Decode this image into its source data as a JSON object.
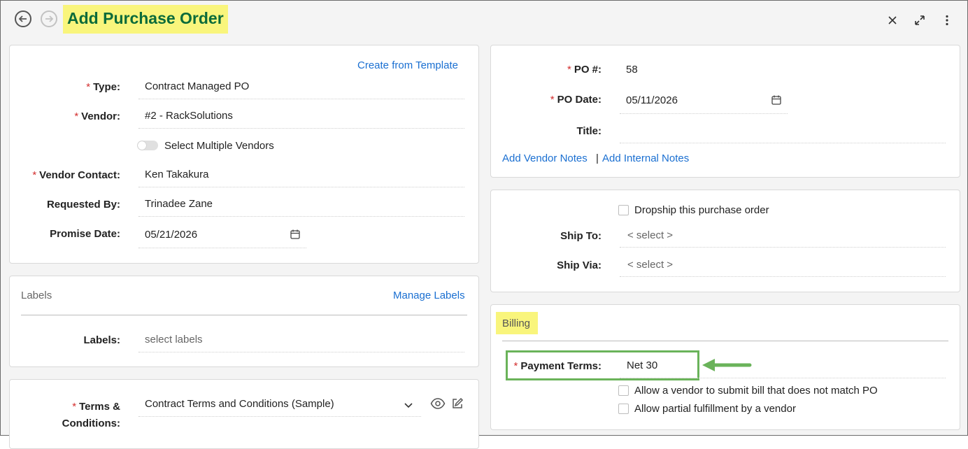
{
  "header": {
    "title": "Add Purchase Order",
    "back_icon": "arrow-left-circle-icon",
    "forward_icon": "arrow-right-circle-icon",
    "close_icon": "close-icon",
    "expand_icon": "expand-icon",
    "more_icon": "more-vertical-icon"
  },
  "general": {
    "create_from_template": "Create from Template",
    "type_label": "Type:",
    "type_value": "Contract Managed PO",
    "vendor_label": "Vendor:",
    "vendor_value": "#2 - RackSolutions",
    "multi_vendor_label": "Select Multiple Vendors",
    "vendor_contact_label": "Vendor Contact:",
    "vendor_contact_value": "Ken Takakura",
    "requested_by_label": "Requested By:",
    "requested_by_value": "Trinadee Zane",
    "promise_date_label": "Promise Date:",
    "promise_date_value": "05/21/2026"
  },
  "labels_section": {
    "title": "Labels",
    "manage_labels": "Manage Labels",
    "labels_label": "Labels:",
    "labels_placeholder": "select labels"
  },
  "terms": {
    "label_line1": "Terms &",
    "label_line2": "Conditions:",
    "value": "Contract Terms and Conditions (Sample)"
  },
  "po": {
    "po_num_label": "PO #:",
    "po_num_value": "58",
    "po_date_label": "PO Date:",
    "po_date_value": "05/11/2026",
    "title_label": "Title:",
    "add_vendor_notes": "Add Vendor Notes",
    "separator": "|",
    "add_internal_notes": "Add Internal Notes"
  },
  "shipping": {
    "dropship_label": "Dropship this purchase order",
    "ship_to_label": "Ship To:",
    "ship_to_value": "< select >",
    "ship_via_label": "Ship Via:",
    "ship_via_value": "< select >"
  },
  "billing": {
    "title": "Billing",
    "payment_terms_label": "Payment Terms:",
    "payment_terms_value": "Net 30",
    "allow_bill_mismatch": "Allow a vendor to submit bill that does not match PO",
    "allow_partial": "Allow partial fulfillment by a vendor"
  },
  "required_marker": "*",
  "colors": {
    "highlight": "#f9f57c",
    "title_green": "#0b6b3a",
    "link_blue": "#1a6fd1",
    "required_red": "#d32f2f",
    "annotation_green": "#6ab35a"
  }
}
